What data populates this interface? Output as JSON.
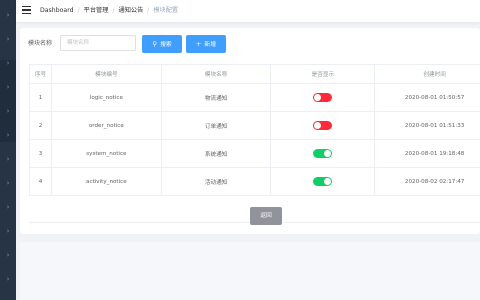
{
  "breadcrumb": [
    "Dashboard",
    "平台管理",
    "通知公告",
    "模块配置"
  ],
  "search": {
    "label": "模块名称",
    "placeholder": "模块名称",
    "value": ""
  },
  "buttons": {
    "search": "搜索",
    "add": "新增",
    "back": "返回"
  },
  "table": {
    "headers": [
      "序号",
      "模块编号",
      "模块名称",
      "是否显示",
      "创建时间"
    ],
    "rows": [
      {
        "index": "1",
        "code": "logic_notice",
        "name": "物流通知",
        "show": false,
        "created": "2020-08-01 01:50:57"
      },
      {
        "index": "2",
        "code": "order_notice",
        "name": "订单通知",
        "show": false,
        "created": "2020-08-01 01:51:33"
      },
      {
        "index": "3",
        "code": "system_notice",
        "name": "系统通知",
        "show": true,
        "created": "2020-08-01 19:18:48"
      },
      {
        "index": "4",
        "code": "activity_notice",
        "name": "活动通知",
        "show": true,
        "created": "2020-08-02 02:17:47"
      }
    ]
  },
  "icons": {
    "sidebar_toggle": "hamburger-icon",
    "search": "search-icon",
    "add": "plus-icon",
    "nav_chevron": "chevron-right-icon"
  },
  "colors": {
    "primary": "#409eff",
    "switch_on": "#13ce66",
    "switch_off": "#ff2b3a",
    "back_button": "#909399",
    "sidebar": "#263445"
  }
}
